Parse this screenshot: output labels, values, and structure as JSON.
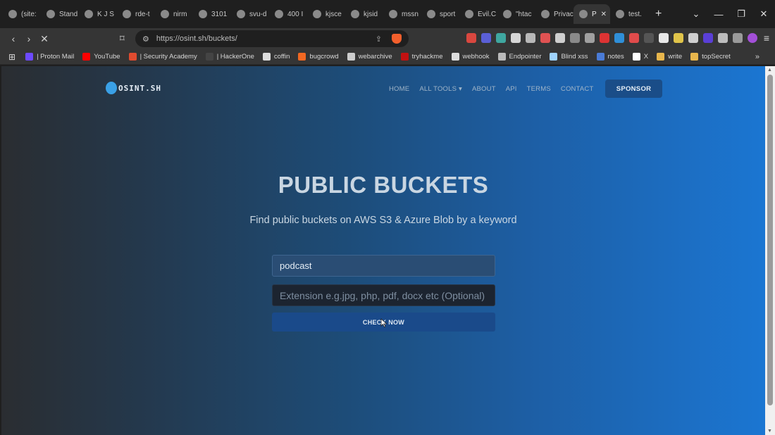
{
  "tabs": [
    {
      "label": "(site:",
      "active": false
    },
    {
      "label": "Stand",
      "active": false
    },
    {
      "label": "K J S",
      "active": false
    },
    {
      "label": "rde-t",
      "active": false
    },
    {
      "label": "nirm",
      "active": false
    },
    {
      "label": "3101",
      "active": false
    },
    {
      "label": "svu-d",
      "active": false
    },
    {
      "label": "400 I",
      "active": false
    },
    {
      "label": "kjsce",
      "active": false
    },
    {
      "label": "kjsid",
      "active": false
    },
    {
      "label": "mssn",
      "active": false
    },
    {
      "label": "sport",
      "active": false
    },
    {
      "label": "Evil.C",
      "active": false
    },
    {
      "label": "\"htac",
      "active": false
    },
    {
      "label": "Privacy e",
      "active": false
    },
    {
      "label": "P",
      "active": true
    },
    {
      "label": "test.",
      "active": false
    }
  ],
  "toolbar": {
    "url": "https://osint.sh/buckets/"
  },
  "bookmarks": [
    {
      "label": "| Proton Mail",
      "color": "#6d4aff"
    },
    {
      "label": "YouTube",
      "color": "#ff0000"
    },
    {
      "label": "| Security Academy",
      "color": "#e04b2f"
    },
    {
      "label": "| HackerOne",
      "color": "#444444"
    },
    {
      "label": "coffin",
      "color": "#dddddd"
    },
    {
      "label": "bugcrowd",
      "color": "#f26822"
    },
    {
      "label": "webarchive",
      "color": "#cccccc"
    },
    {
      "label": "tryhackme",
      "color": "#c11111"
    },
    {
      "label": "webhook",
      "color": "#dddddd"
    },
    {
      "label": "Endpointer",
      "color": "#bbbbbb"
    },
    {
      "label": "Blind xss",
      "color": "#9fd3ff"
    },
    {
      "label": "notes",
      "color": "#4a7bd6"
    },
    {
      "label": "X",
      "color": "#ffffff"
    },
    {
      "label": "write",
      "color": "#e8b64c"
    },
    {
      "label": "topSecret",
      "color": "#e8b64c"
    }
  ],
  "site": {
    "logo": "OSINT.SH",
    "nav": [
      "HOME",
      "ALL TOOLS",
      "ABOUT",
      "API",
      "TERMS",
      "CONTACT"
    ],
    "sponsor": "SPONSOR",
    "title": "PUBLIC BUCKETS",
    "subtitle": "Find public buckets on AWS S3 & Azure Blob by a keyword",
    "keyword_value": "podcast",
    "extension_placeholder": "Extension e.g.jpg, php, pdf, docx etc (Optional)",
    "check_button": "CHECK NOW"
  },
  "colors": {
    "accent": "#1a4a8a",
    "page_left": "#2a2d31",
    "page_right": "#1b76d2"
  }
}
